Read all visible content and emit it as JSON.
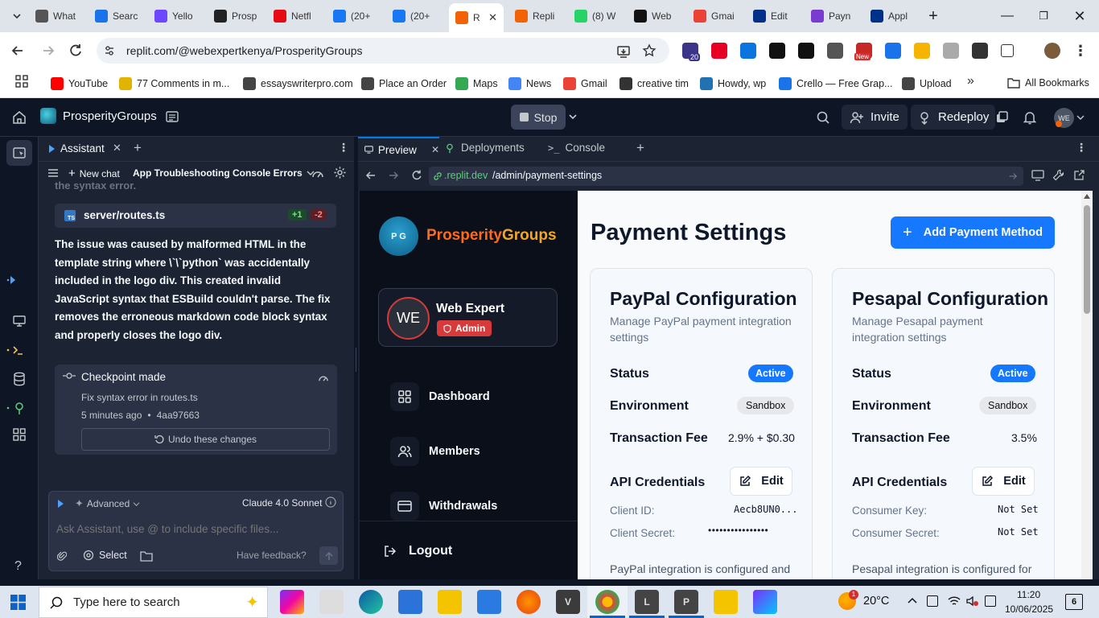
{
  "browser": {
    "tabs": [
      {
        "label": "What",
        "color": "#555"
      },
      {
        "label": "Searc",
        "color": "#1a73e8"
      },
      {
        "label": "Yello",
        "color": "#6c47ff"
      },
      {
        "label": "Prosp",
        "color": "#222"
      },
      {
        "label": "Netfl",
        "color": "#e50914"
      },
      {
        "label": "(20+",
        "color": "#1877f2"
      },
      {
        "label": "(20+",
        "color": "#1877f2"
      },
      {
        "label": "R",
        "color": "#f26207"
      },
      {
        "label": "Repli",
        "color": "#f26207"
      },
      {
        "label": "(8) W",
        "color": "#25d366"
      },
      {
        "label": "Web",
        "color": "#111"
      },
      {
        "label": "Gmai",
        "color": "#ea4335"
      },
      {
        "label": "Edit",
        "color": "#003087"
      },
      {
        "label": "Payn",
        "color": "#7a3cd0"
      },
      {
        "label": "Appl",
        "color": "#003087"
      }
    ],
    "url": "replit.com/@webexpertkenya/ProsperityGroups",
    "bookmarks": [
      {
        "label": "YouTube",
        "color": "#ff0000"
      },
      {
        "label": "77 Comments in m...",
        "color": "#e0b400"
      },
      {
        "label": "essayswriterpro.com",
        "color": "#444"
      },
      {
        "label": "Place an Order",
        "color": "#444"
      },
      {
        "label": "Maps",
        "color": "#34a853"
      },
      {
        "label": "News",
        "color": "#4285f4"
      },
      {
        "label": "Gmail",
        "color": "#ea4335"
      },
      {
        "label": "creative tim",
        "color": "#333"
      },
      {
        "label": "Howdy, wp",
        "color": "#2271b1"
      },
      {
        "label": "Crello — Free Grap...",
        "color": "#1a73e8"
      },
      {
        "label": "Upload",
        "color": "#444"
      }
    ],
    "all_bookmarks": "All Bookmarks",
    "ext_badge_20": "20",
    "ext_badge_new": "New"
  },
  "replit": {
    "project": "ProsperityGroups",
    "stop": "Stop",
    "invite": "Invite",
    "redeploy": "Redeploy",
    "avatar": "WE"
  },
  "assistant": {
    "tab": "Assistant",
    "new_chat": "New chat",
    "thread": "App Troubleshooting Console Errors",
    "cut_text": "the syntax error.",
    "file": {
      "name": "server/routes.ts",
      "icon": "TS",
      "added": "+1",
      "removed": "-2"
    },
    "message": "The issue was caused by malformed HTML in the template string where \\`\\`python` was accidentally included in the logo div. This created invalid JavaScript syntax that ESBuild couldn't parse. The fix removes the erroneous markdown code block syntax and properly closes the logo div.",
    "checkpoint": {
      "title": "Checkpoint made",
      "desc": "Fix syntax error in routes.ts",
      "time": "5 minutes ago",
      "sep": "•",
      "hash": "4aa97663",
      "undo": "Undo these changes"
    },
    "mode": "Advanced",
    "model": "Claude 4.0 Sonnet",
    "placeholder": "Ask Assistant, use @ to include specific files...",
    "select": "Select",
    "feedback": "Have feedback?"
  },
  "workspace": {
    "tabs": {
      "preview": "Preview",
      "deployments": "Deployments",
      "console": "Console"
    },
    "url_domain": ".replit.dev",
    "url_path": "/admin/payment-settings"
  },
  "app": {
    "brand_a": "Prosperity",
    "brand_b": "Groups",
    "logo_letters": "P G",
    "user_initials": "WE",
    "user_name": "Web Expert",
    "user_role": "Admin",
    "nav": [
      "Dashboard",
      "Members",
      "Withdrawals"
    ],
    "logout": "Logout",
    "page_title": "Payment Settings",
    "add_btn": "Add Payment Method",
    "paypal": {
      "title": "PayPal Configuration",
      "subtitle": "Manage PayPal payment integration settings",
      "status_label": "Status",
      "status": "Active",
      "env_label": "Environment",
      "env": "Sandbox",
      "fee_label": "Transaction Fee",
      "fee": "2.9% + $0.30",
      "api_label": "API Credentials",
      "edit": "Edit",
      "k1": "Client ID:",
      "v1": "Aecb8UN0...",
      "k2": "Client Secret:",
      "v2": "••••••••••••••••",
      "note": "PayPal integration is configured and"
    },
    "pesapal": {
      "title": "Pesapal Configuration",
      "subtitle": "Manage Pesapal payment integration settings",
      "status_label": "Status",
      "status": "Active",
      "env_label": "Environment",
      "env": "Sandbox",
      "fee_label": "Transaction Fee",
      "fee": "3.5%",
      "api_label": "API Credentials",
      "edit": "Edit",
      "k1": "Consumer Key:",
      "v1": "Not Set",
      "k2": "Consumer Secret:",
      "v2": "Not Set",
      "note": "Pesapal integration is configured for"
    }
  },
  "taskbar": {
    "search": "Type here to search",
    "temp": "20°C",
    "time": "11:20",
    "date": "10/06/2025",
    "notif": "6",
    "weather_badge": "1",
    "apps": {
      "app1": "V",
      "app2": "L",
      "app3": "P"
    }
  }
}
